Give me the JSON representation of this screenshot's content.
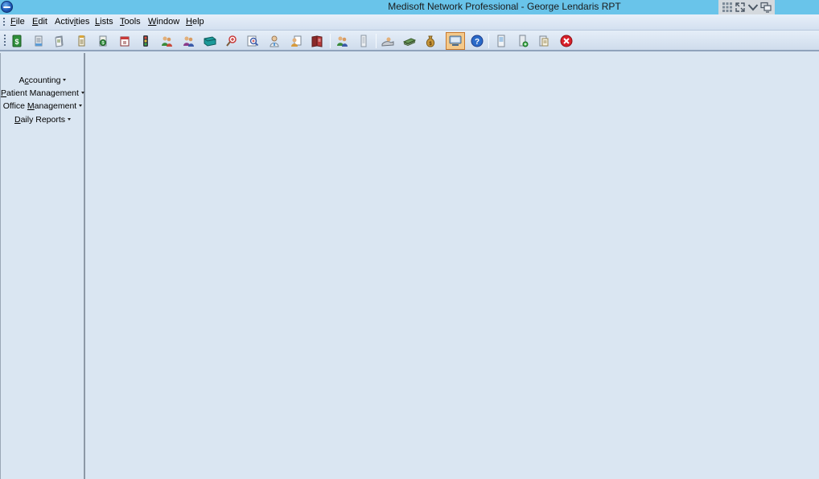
{
  "window": {
    "title": "Medisoft Network Professional - George Lendaris RPT"
  },
  "menu": [
    {
      "key": "file",
      "pre": "",
      "accel": "F",
      "post": "ile"
    },
    {
      "key": "edit",
      "pre": "",
      "accel": "E",
      "post": "dit"
    },
    {
      "key": "activities",
      "pre": "Activ",
      "accel": "i",
      "post": "ties"
    },
    {
      "key": "lists",
      "pre": "",
      "accel": "L",
      "post": "ists"
    },
    {
      "key": "tools",
      "pre": "",
      "accel": "T",
      "post": "ools"
    },
    {
      "key": "window",
      "pre": "",
      "accel": "W",
      "post": "indow"
    },
    {
      "key": "help",
      "pre": "",
      "accel": "H",
      "post": "elp"
    }
  ],
  "toolbar_icons": [
    "transaction-entry-icon",
    "claim-management-icon",
    "statement-management-icon",
    "collection-list-icon",
    "deposit-list-icon",
    "appointment-book-icon",
    "office-hours-icon",
    "patient-list-icon",
    "patient-recall-icon",
    "quick-ledger-icon",
    "quick-balance-icon",
    "patient-quick-entry-icon",
    "final-draft-icon",
    "report-designer-icon",
    "provider-list-icon",
    "referring-provider-list-icon",
    "insurance-carrier-list-icon",
    "procedure-codes-icon",
    "money-bag-icon",
    "show-hide-hints-icon",
    "help-icon",
    "custom-report-list-icon",
    "backup-data-icon",
    "restore-data-icon",
    "exit-icon"
  ],
  "sidebar": {
    "items": [
      {
        "pre": "A",
        "accel": "c",
        "post": "counting"
      },
      {
        "pre": "",
        "accel": "P",
        "post": "atient Management"
      },
      {
        "pre": "Office ",
        "accel": "M",
        "post": "anagement"
      },
      {
        "pre": "",
        "accel": "D",
        "post": "aily Reports"
      }
    ]
  },
  "colors": {
    "titlebar": "#69c4ea",
    "workspace": "#dae6f2",
    "active_button": "#f4c98a",
    "exit_red": "#d9202a"
  }
}
